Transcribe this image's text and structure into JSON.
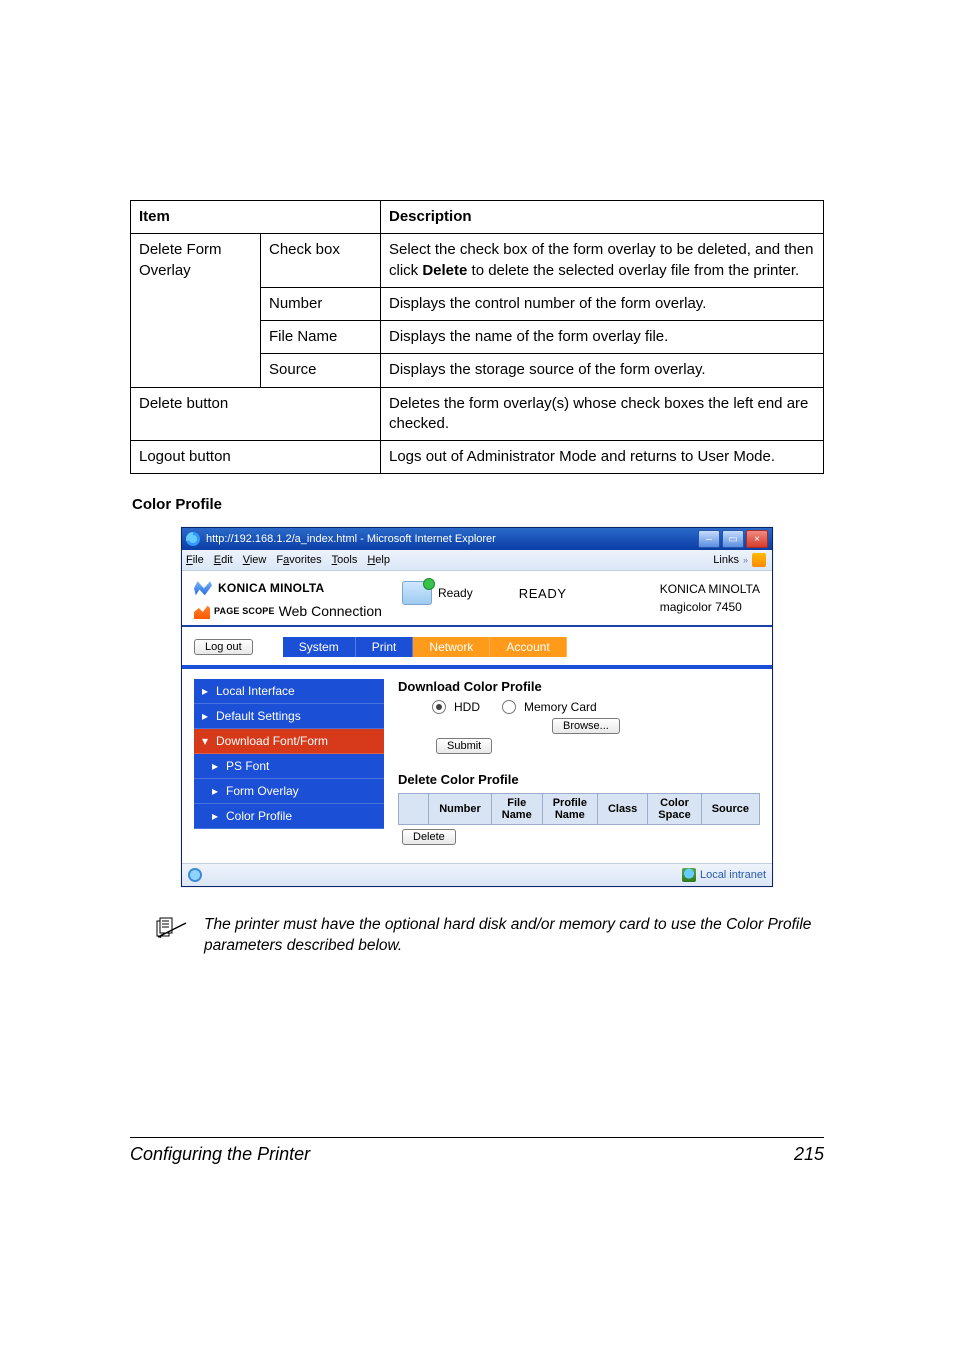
{
  "table": {
    "head": {
      "item": "Item",
      "desc": "Description"
    },
    "rows": [
      {
        "c1": "Delete Form Overlay",
        "c2": "Check box",
        "c3": "Select the check box of the form overlay to be deleted, and then click Delete to delete the selected overlay file from the printer.",
        "r1span": 4
      },
      {
        "c2": "Number",
        "c3": "Displays the control number of the form overlay."
      },
      {
        "c2": "File Name",
        "c3": "Displays the name of the form overlay file."
      },
      {
        "c2": "Source",
        "c3": "Displays the storage source of the form overlay."
      },
      {
        "c1": "Delete button",
        "colspan12": true,
        "c3": "Deletes the form overlay(s) whose check boxes the left end are checked."
      },
      {
        "c1": "Logout button",
        "colspan12": true,
        "c3": "Logs out of Administrator Mode and returns to User Mode."
      }
    ],
    "delete_word": "Delete"
  },
  "section_head": "Color Profile",
  "ie": {
    "title": "http://192.168.1.2/a_index.html - Microsoft Internet Explorer",
    "menu": {
      "file": "File",
      "edit": "Edit",
      "view": "View",
      "favorites": "Favorites",
      "tools": "Tools",
      "help": "Help",
      "links": "Links"
    },
    "hdr": {
      "brand": "KONICA MINOLTA",
      "pagescope_small": "PAGE SCOPE",
      "pagescope": "Web Connection",
      "ready_small": "Ready",
      "ready_big": "READY",
      "right1": "KONICA MINOLTA",
      "right2": "magicolor 7450"
    },
    "logout": "Log out",
    "tabs": {
      "system": "System",
      "print": "Print",
      "network": "Network",
      "account": "Account"
    },
    "side": {
      "local": "Local Interface",
      "default": "Default Settings",
      "download": "Download Font/Form",
      "ps": "PS Font",
      "form": "Form Overlay",
      "color": "Color Profile"
    },
    "main": {
      "h1": "Download Color Profile",
      "hdd": "HDD",
      "mem": "Memory Card",
      "browse": "Browse...",
      "submit": "Submit",
      "h2": "Delete Color Profile",
      "cols": {
        "number": "Number",
        "filename": "File Name",
        "profile": "Profile Name",
        "class": "Class",
        "cspace": "Color Space",
        "source": "Source"
      },
      "delete": "Delete"
    },
    "status": "Local intranet"
  },
  "note": "The printer must have the optional hard disk and/or memory card to use the Color Profile parameters described below.",
  "footer": {
    "title": "Configuring the Printer",
    "page": "215"
  }
}
